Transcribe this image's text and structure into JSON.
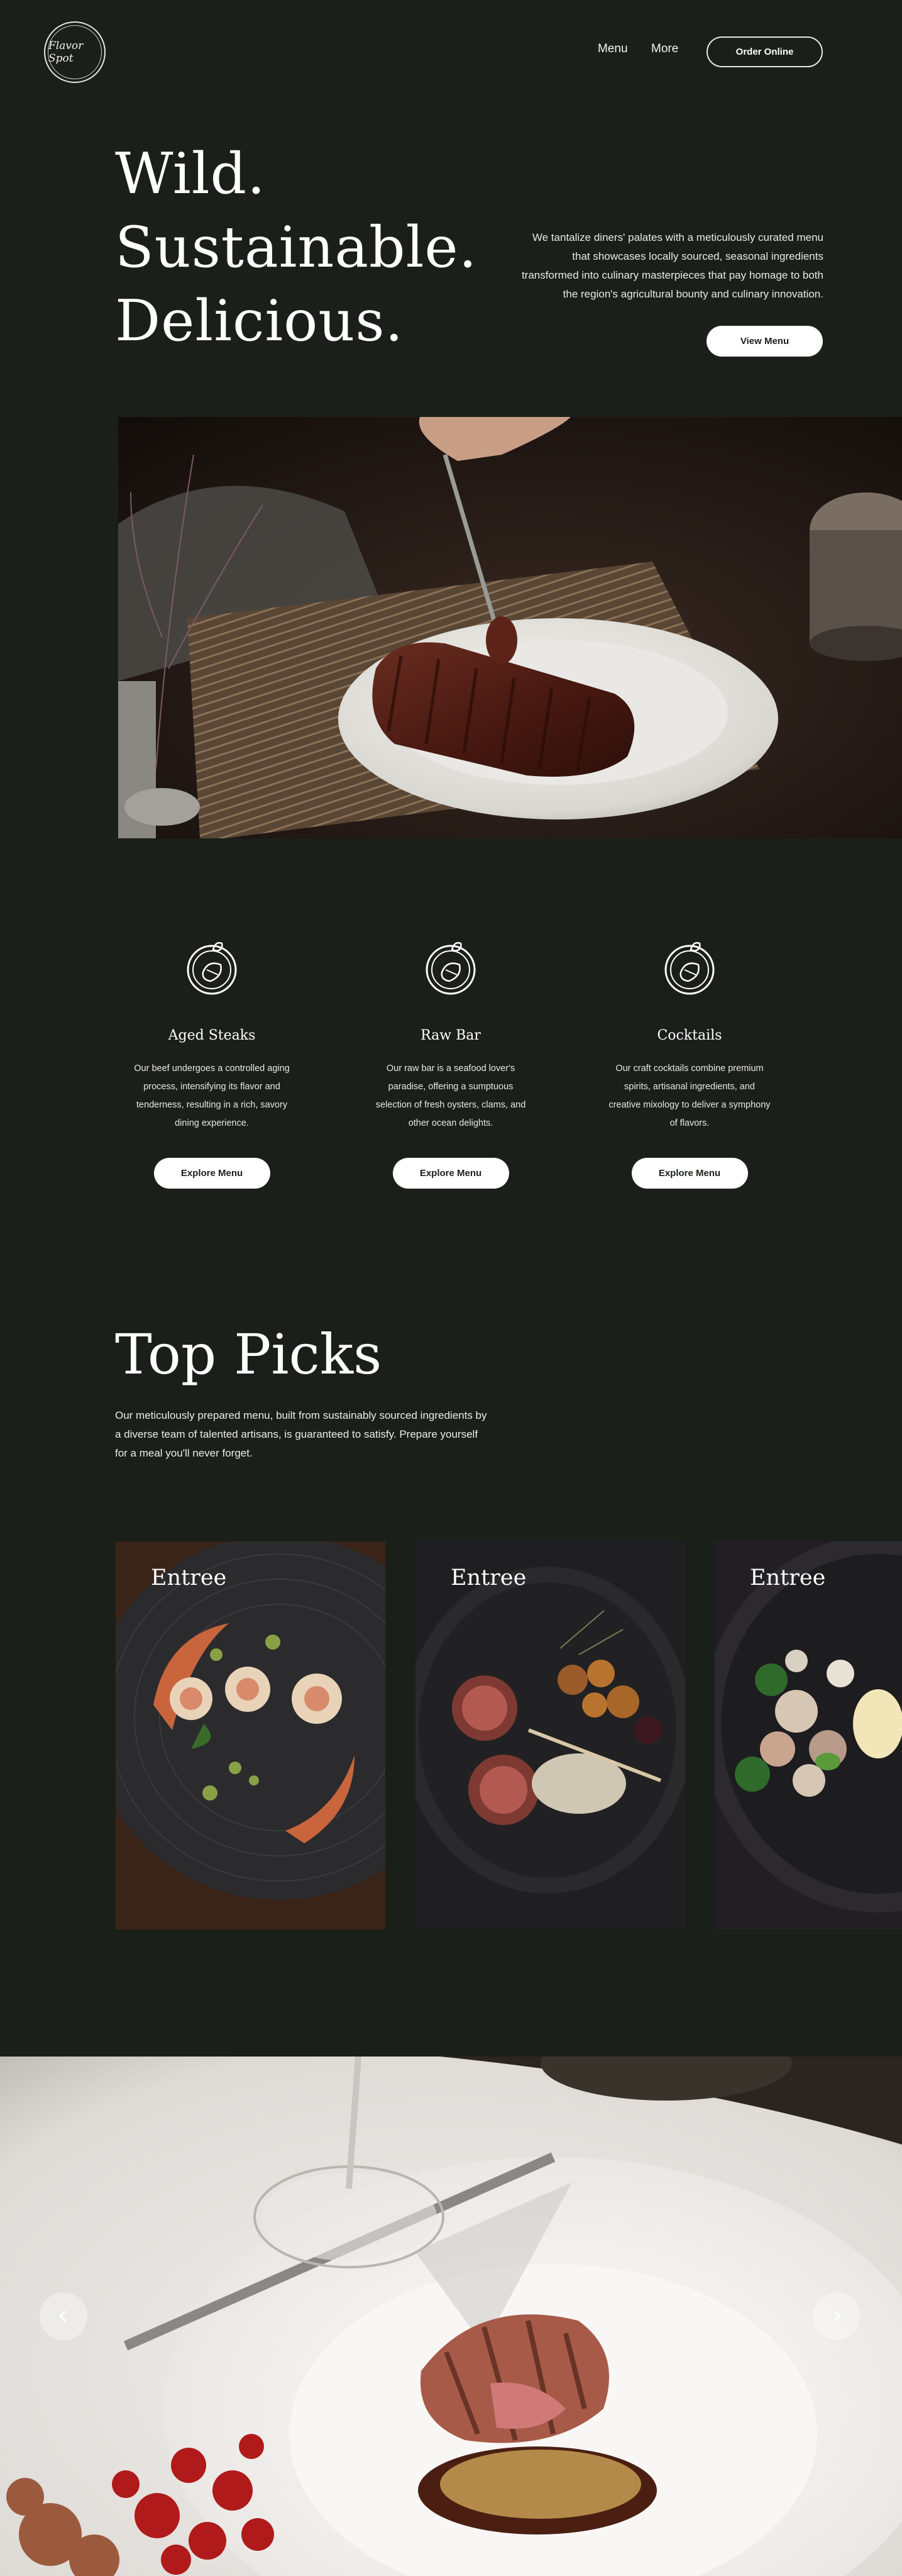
{
  "header": {
    "logo_text": "Flavor Spot",
    "nav": [
      {
        "label": "Menu"
      },
      {
        "label": "More"
      }
    ],
    "order_button": "Order Online"
  },
  "hero": {
    "title_lines": [
      "Wild.",
      "Sustainable.",
      "Delicious."
    ],
    "description": "We tantalize diners' palates with a meticulously curated menu that showcases locally sourced, seasonal ingredients transformed into culinary masterpieces that pay homage to both the region's agricultural bounty and culinary innovation.",
    "button": "View Menu"
  },
  "features": [
    {
      "title": "Aged Steaks",
      "description": "Our beef undergoes a controlled aging process, intensifying its flavor and tenderness, resulting in a rich, savory dining experience.",
      "button": "Explore Menu",
      "icon": "dish-icon"
    },
    {
      "title": "Raw Bar",
      "description": "Our raw bar is a seafood lover's paradise, offering a sumptuous selection of  fresh oysters, clams, and other ocean delights.",
      "button": "Explore  Menu",
      "icon": "dish-icon"
    },
    {
      "title": "Cocktails",
      "description": "Our craft cocktails combine premium spirits, artisanal ingredients, and creative mixology to  deliver a symphony of flavors.",
      "button": "Explore Menu",
      "icon": "dish-icon"
    }
  ],
  "top_picks": {
    "title": "Top Picks",
    "description": "Our meticulously prepared menu, built from sustainably sourced ingredients by a diverse team of talented artisans, is guaranteed to satisfy. Prepare yourself for a meal you'll never forget.",
    "cards": [
      {
        "label": "Entree"
      },
      {
        "label": "Entree"
      },
      {
        "label": "Entree"
      }
    ]
  },
  "carousel": {
    "prev_icon": "chevron-left-icon",
    "next_icon": "chevron-right-icon"
  },
  "colors": {
    "background": "#1b1f19",
    "text": "#ffffff",
    "button_bg": "#ffffff"
  }
}
